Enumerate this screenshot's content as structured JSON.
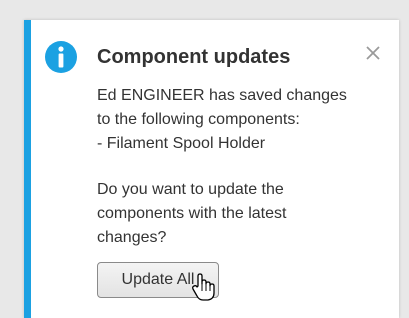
{
  "notification": {
    "title": "Component updates",
    "message_lines": [
      "Ed ENGINEER has saved changes",
      "to the following components:",
      "- Filament Spool Holder"
    ],
    "question_lines": [
      "Do you want to update the",
      "components with the latest",
      "changes?"
    ],
    "update_button_label": "Update All",
    "icon": "info-icon",
    "close_icon": "close-icon"
  },
  "colors": {
    "accent": "#1ba1e2",
    "text": "#333333",
    "background": "#ffffff"
  }
}
